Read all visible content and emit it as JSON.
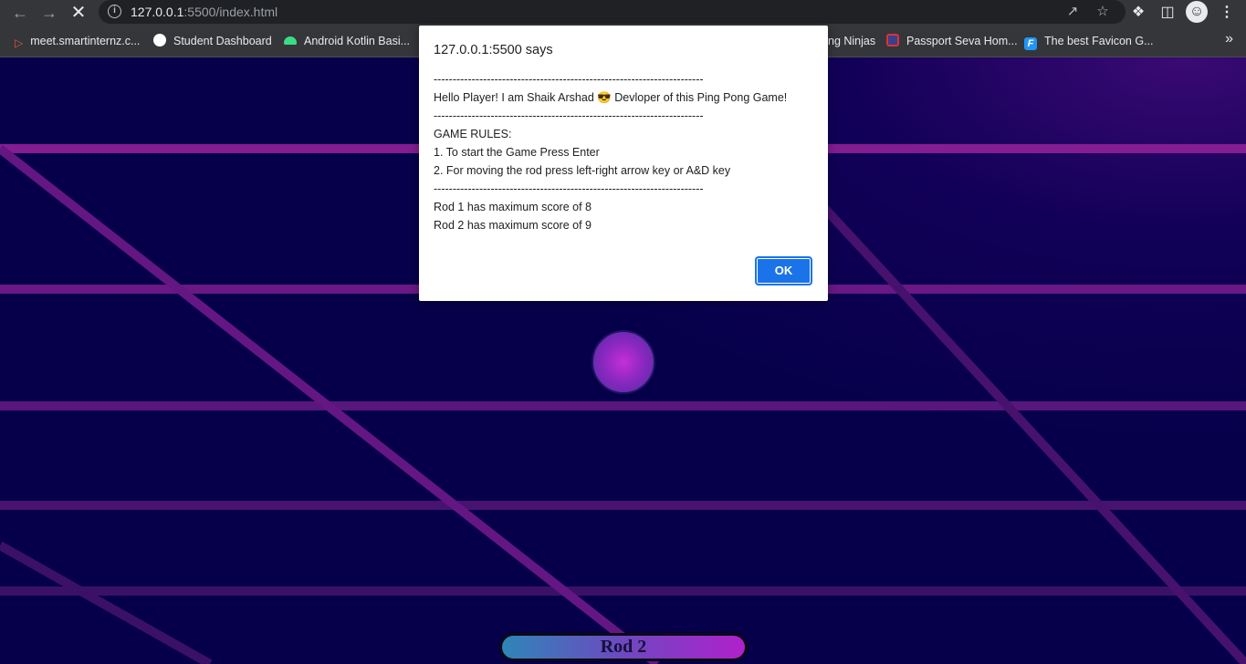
{
  "browser": {
    "url_host": "127.0.0.1",
    "url_rest": ":5500/index.html",
    "icons": {
      "back": "arrow-left-icon",
      "forward": "arrow-right-icon",
      "reload": "close-icon",
      "site_info": "info-icon",
      "share": "share-icon",
      "bookmark": "star-icon",
      "extensions": "puzzle-icon",
      "side_panel": "side-panel-icon",
      "profile": "profile-avatar-icon",
      "menu": "kebab-menu-icon"
    }
  },
  "bookmarks": [
    {
      "label": "meet.smartinternz.c...",
      "icon": "smartinternz-icon",
      "color": "#e0533f"
    },
    {
      "label": "Student Dashboard",
      "icon": "globe-icon",
      "color": "#ffffff"
    },
    {
      "label": "Android Kotlin Basi...",
      "icon": "android-icon",
      "color": "#3ddc84"
    },
    {
      "label": "ng Ninjas",
      "icon": "",
      "color": ""
    },
    {
      "label": "Passport Seva Hom...",
      "icon": "passport-seva-icon",
      "color": "#3a3f8f"
    },
    {
      "label": "The best Favicon G...",
      "icon": "favicon-generator-icon",
      "color": "#2196f3"
    }
  ],
  "dialog": {
    "title": "127.0.0.1:5500 says",
    "body": "-----------------------------------------------------------------------\nHello Player! I am Shaik Arshad 😎 Devloper of this Ping Pong Game!\n-----------------------------------------------------------------------\nGAME RULES:\n1. To start the Game Press Enter\n2. For moving the rod press left-right arrow key or A&D key\n-----------------------------------------------------------------------\nRod 1 has maximum score of 8\nRod 2 has maximum score of 9",
    "ok_label": "OK"
  },
  "game": {
    "rod2_label": "Rod 2",
    "colors": {
      "background": "#06004a",
      "grid_line": "#7a1a8c",
      "ball": "#c42fd6"
    }
  }
}
